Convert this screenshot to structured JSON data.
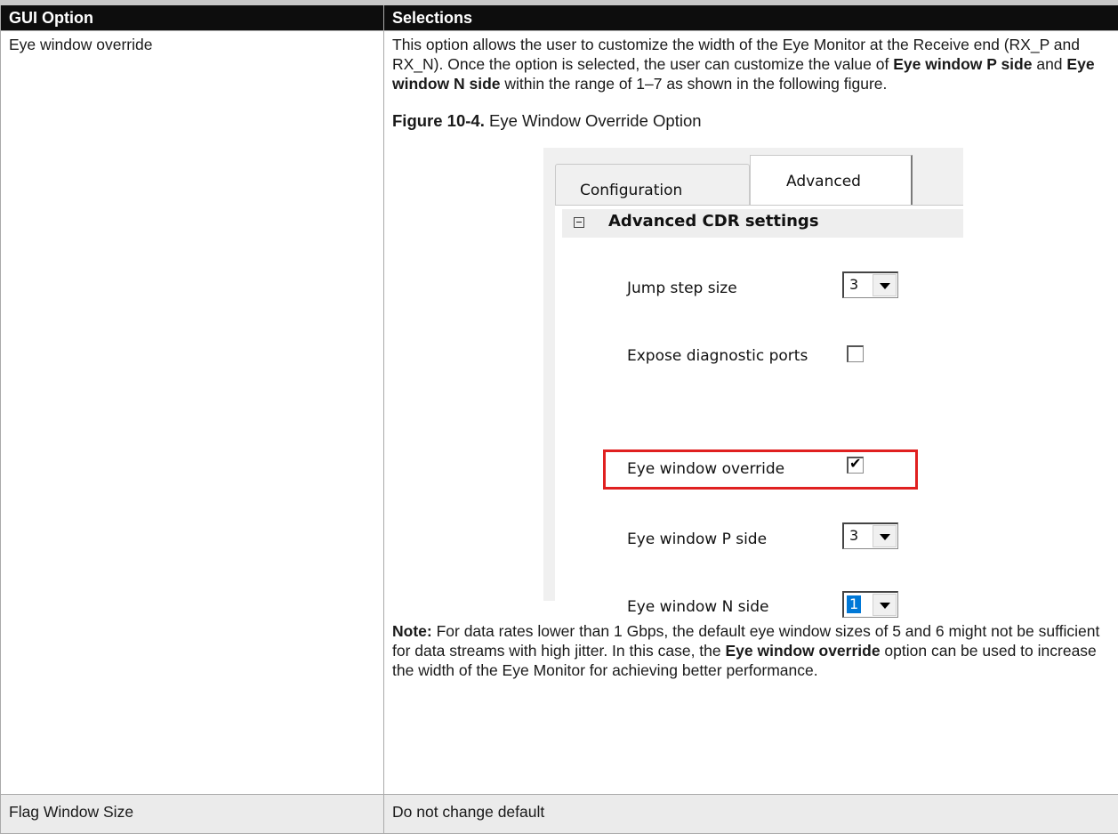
{
  "table": {
    "headers": [
      "GUI Option",
      "Selections"
    ],
    "rows": [
      {
        "option": "Eye window override",
        "desc": {
          "p1": "This option allows the user to customize the width of the Eye Monitor at the Receive end (RX_P and RX_N). Once the option is selected, the user can customize the value of ",
          "b1": "Eye window P side",
          "and": " and ",
          "b2": "Eye window N side",
          "p2": " within the range of 1–7 as shown in the following figure."
        },
        "figure_label": "Figure 10-4.",
        "figure_title": " Eye Window Override Option",
        "note": {
          "label": "Note:",
          "t1": "  For data rates lower than 1 Gbps, the default eye window sizes of 5 and 6 might not be sufficient for data streams with high jitter. In this case, the ",
          "b": "Eye window override",
          "t2": " option can be used to increase the width of the Eye Monitor for achieving better performance."
        }
      },
      {
        "option": "Flag Window Size",
        "desc": "Do not change default"
      }
    ]
  },
  "figure": {
    "tabs": [
      "Configuration",
      "Advanced"
    ],
    "active_tab": "Advanced",
    "section_title": "Advanced CDR settings",
    "fields": {
      "jump_step": {
        "label": "Jump step size",
        "value": "3"
      },
      "diag_ports": {
        "label": "Expose diagnostic ports",
        "checked": false
      },
      "eye_override": {
        "label": "Eye window override",
        "checked": true,
        "mark": "✔"
      },
      "eye_p": {
        "label": "Eye window P side",
        "value": "3"
      },
      "eye_n": {
        "label": "Eye window N side",
        "value": "1"
      }
    },
    "highlight_color": "#e02020"
  }
}
